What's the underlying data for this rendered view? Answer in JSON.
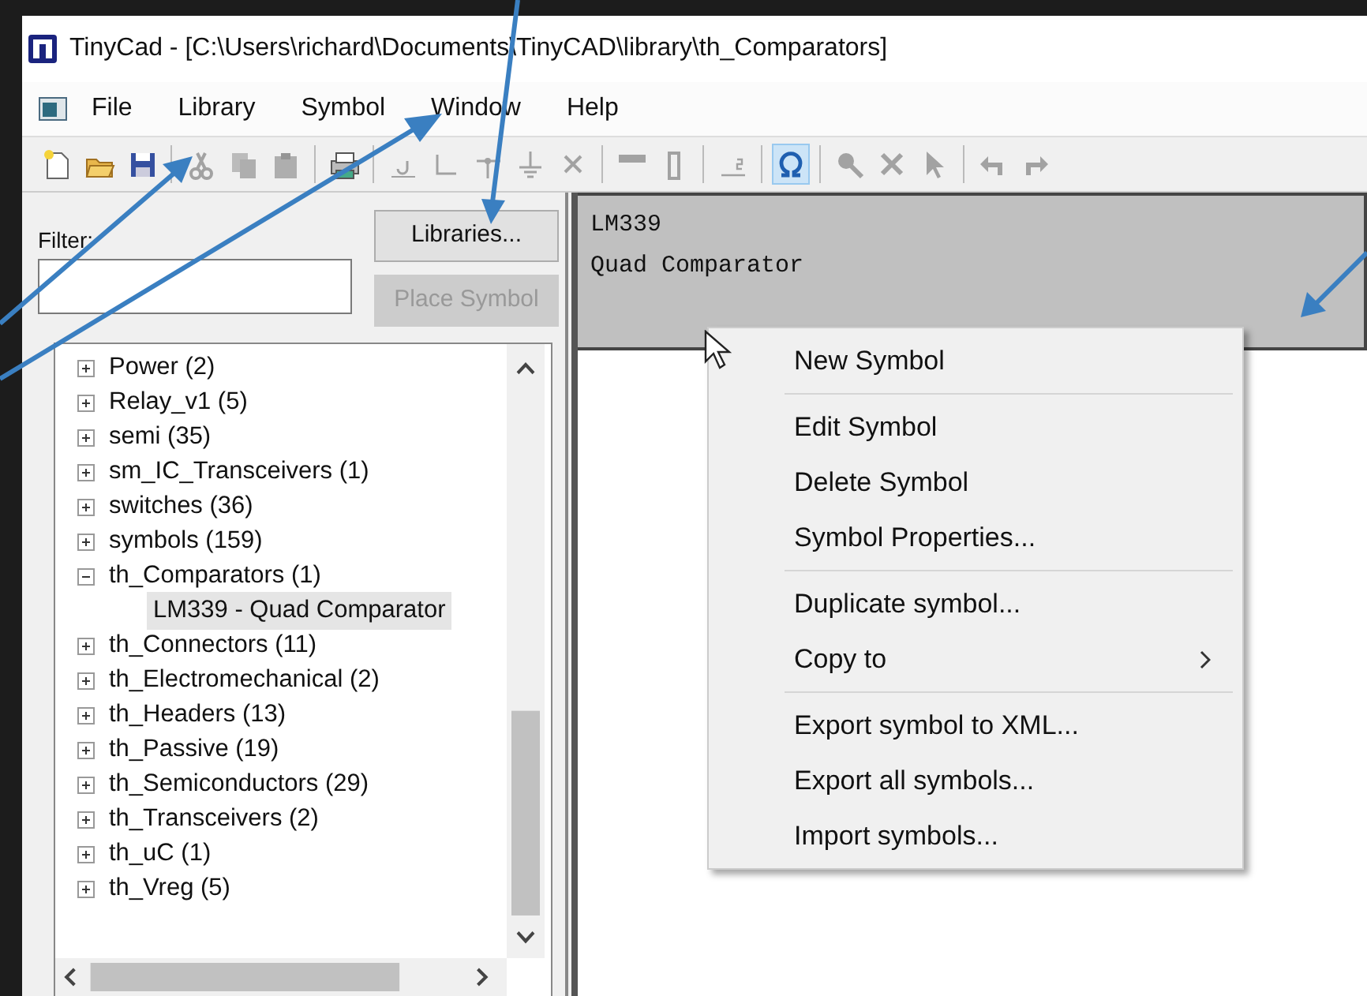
{
  "window": {
    "title": "TinyCad - [C:\\Users\\richard\\Documents\\TinyCAD\\library\\th_Comparators]"
  },
  "menu_bar": [
    "File",
    "Library",
    "Symbol",
    "Window",
    "Help"
  ],
  "toolbar": [
    {
      "kind": "new",
      "disabled": false,
      "selected": false
    },
    {
      "kind": "open",
      "disabled": false,
      "selected": false
    },
    {
      "kind": "save",
      "disabled": false,
      "selected": false
    },
    {
      "kind": "sep"
    },
    {
      "kind": "cut",
      "disabled": true,
      "selected": false
    },
    {
      "kind": "copy",
      "disabled": true,
      "selected": false
    },
    {
      "kind": "paste",
      "disabled": true,
      "selected": false
    },
    {
      "kind": "sep"
    },
    {
      "kind": "print",
      "disabled": false,
      "selected": false
    },
    {
      "kind": "sep"
    },
    {
      "kind": "text",
      "disabled": true,
      "selected": false
    },
    {
      "kind": "wire",
      "disabled": true,
      "selected": false
    },
    {
      "kind": "pin",
      "disabled": true,
      "selected": false
    },
    {
      "kind": "ground",
      "disabled": true,
      "selected": false
    },
    {
      "kind": "cross",
      "disabled": true,
      "selected": false
    },
    {
      "kind": "sep"
    },
    {
      "kind": "bar",
      "disabled": true,
      "selected": false
    },
    {
      "kind": "rect",
      "disabled": true,
      "selected": false
    },
    {
      "kind": "sep"
    },
    {
      "kind": "label",
      "disabled": true,
      "selected": false
    },
    {
      "kind": "sep"
    },
    {
      "kind": "omega",
      "disabled": false,
      "selected": true
    },
    {
      "kind": "sep"
    },
    {
      "kind": "zoom",
      "disabled": true,
      "selected": false
    },
    {
      "kind": "cross2",
      "disabled": true,
      "selected": false
    },
    {
      "kind": "pointer",
      "disabled": true,
      "selected": false
    },
    {
      "kind": "sep"
    },
    {
      "kind": "undo",
      "disabled": true,
      "selected": false
    },
    {
      "kind": "redo",
      "disabled": true,
      "selected": false
    }
  ],
  "library_panel": {
    "filter_label": "Filter:",
    "buttons": [
      {
        "label": "Libraries...",
        "disabled": false
      },
      {
        "label": "Place Symbol",
        "disabled": true
      }
    ],
    "tree": [
      {
        "label": "Power (2)",
        "expanded": false,
        "selected": false
      },
      {
        "label": "Relay_v1 (5)",
        "expanded": false,
        "selected": false
      },
      {
        "label": "semi (35)",
        "expanded": false,
        "selected": false
      },
      {
        "label": "sm_IC_Transceivers (1)",
        "expanded": false,
        "selected": false
      },
      {
        "label": "switches (36)",
        "expanded": false,
        "selected": false
      },
      {
        "label": "symbols (159)",
        "expanded": false,
        "selected": false
      },
      {
        "label": "th_Comparators (1)",
        "expanded": true,
        "selected": false,
        "children": [
          {
            "label": "LM339 - Quad Comparator",
            "selected": true
          }
        ]
      },
      {
        "label": "th_Connectors (11)",
        "expanded": false,
        "selected": false
      },
      {
        "label": "th_Electromechanical (2)",
        "expanded": false,
        "selected": false
      },
      {
        "label": "th_Headers (13)",
        "expanded": false,
        "selected": false
      },
      {
        "label": "th_Passive (19)",
        "expanded": false,
        "selected": false
      },
      {
        "label": "th_Semiconductors (29)",
        "expanded": false,
        "selected": false
      },
      {
        "label": "th_Transceivers (2)",
        "expanded": false,
        "selected": false
      },
      {
        "label": "th_uC (1)",
        "expanded": false,
        "selected": false
      },
      {
        "label": "th_Vreg (5)",
        "expanded": false,
        "selected": false
      }
    ]
  },
  "symbol_preview": {
    "name": "LM339",
    "description": "Quad Comparator"
  },
  "context_menu": {
    "sections": [
      {
        "items": [
          {
            "label": "New Symbol",
            "submenu": false
          }
        ]
      },
      {
        "items": [
          {
            "label": "Edit Symbol",
            "submenu": false
          },
          {
            "label": "Delete Symbol",
            "submenu": false
          },
          {
            "label": "Symbol Properties...",
            "submenu": false
          }
        ]
      },
      {
        "items": [
          {
            "label": "Duplicate symbol...",
            "submenu": false
          },
          {
            "label": "Copy to",
            "submenu": true
          }
        ]
      },
      {
        "items": [
          {
            "label": "Export symbol to XML...",
            "submenu": false
          },
          {
            "label": "Export all symbols...",
            "submenu": false
          },
          {
            "label": "Import symbols...",
            "submenu": false
          }
        ]
      }
    ]
  }
}
